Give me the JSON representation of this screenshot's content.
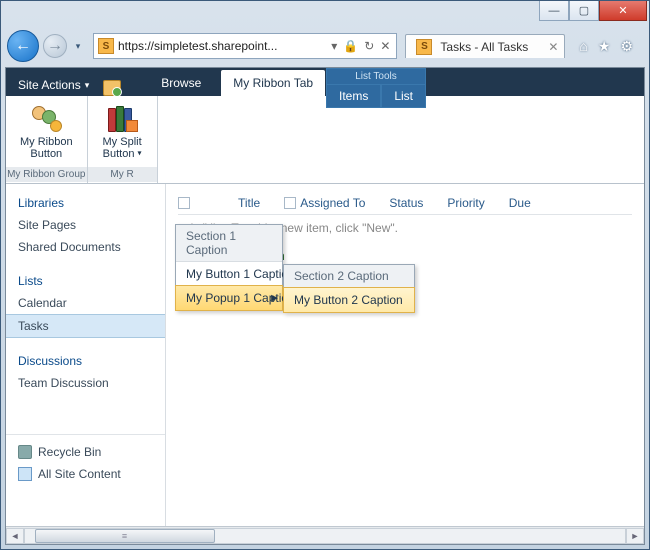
{
  "browser": {
    "url": "https://simpletest.sharepoint...",
    "tab_title": "Tasks - All Tasks"
  },
  "ribbon": {
    "site_actions": "Site Actions",
    "tabs": {
      "browse": "Browse",
      "custom": "My Ribbon Tab"
    },
    "list_tools": {
      "label": "List Tools",
      "items": "Items",
      "list": "List"
    },
    "groups": {
      "g1": {
        "label": "My Ribbon Group",
        "button": "My Ribbon\nButton"
      },
      "g2": {
        "label": "My R",
        "button": "My Split\nButton"
      }
    }
  },
  "menu1": {
    "section": "Section 1 Caption",
    "item1": "My Button 1 Caption",
    "item2": "My Popup 1 Caption"
  },
  "menu2": {
    "section": "Section 2 Caption",
    "item1": "My Button 2 Caption"
  },
  "sidebar": {
    "libraries": "Libraries",
    "site_pages": "Site Pages",
    "shared_docs": "Shared Documents",
    "lists": "Lists",
    "calendar": "Calendar",
    "tasks": "Tasks",
    "discussions": "Discussions",
    "team_discussion": "Team Discussion",
    "recycle": "Recycle Bin",
    "all_content": "All Site Content"
  },
  "list": {
    "cols": {
      "c0": "",
      "c1": "Title",
      "c2": "Assigned To",
      "c3": "Status",
      "c4": "Priority",
      "c5": "Due"
    },
    "empty": "asks\" list. To add a new item, click \"New\".",
    "add_new": "Add new item"
  }
}
